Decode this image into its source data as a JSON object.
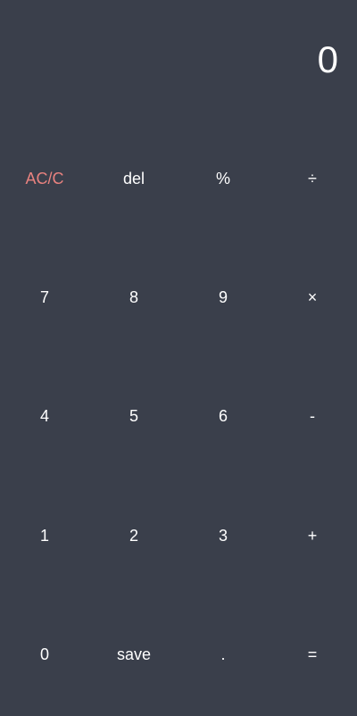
{
  "display": {
    "value": "0"
  },
  "colors": {
    "background": "#3a3f4b",
    "text": "#ffffff",
    "clear_accent": "#e8827f"
  },
  "keys": {
    "clear": "AC/C",
    "delete": "del",
    "percent": "%",
    "divide": "÷",
    "seven": "7",
    "eight": "8",
    "nine": "9",
    "multiply": "×",
    "four": "4",
    "five": "5",
    "six": "6",
    "subtract": "-",
    "one": "1",
    "two": "2",
    "three": "3",
    "add": "+",
    "zero": "0",
    "save": "save",
    "decimal": ".",
    "equals": "="
  }
}
